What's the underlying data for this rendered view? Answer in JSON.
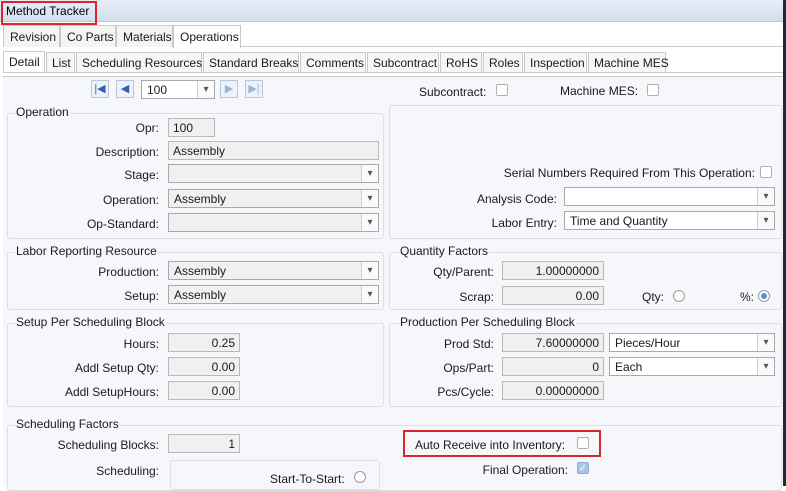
{
  "window": {
    "title": "Method Tracker"
  },
  "main_tabs": [
    {
      "label": "Revision",
      "active": false
    },
    {
      "label": "Co Parts",
      "active": false
    },
    {
      "label": "Materials",
      "active": false
    },
    {
      "label": "Operations",
      "active": true
    }
  ],
  "sub_tabs": [
    {
      "label": "Detail",
      "active": true
    },
    {
      "label": "List"
    },
    {
      "label": "Scheduling Resources"
    },
    {
      "label": "Standard Breaks"
    },
    {
      "label": "Comments"
    },
    {
      "label": "Subcontract"
    },
    {
      "label": "RoHS"
    },
    {
      "label": "Roles"
    },
    {
      "label": "Inspection"
    },
    {
      "label": "Machine MES"
    }
  ],
  "navigator": {
    "value": "100"
  },
  "top_flags": {
    "subcontract_label": "Subcontract:",
    "machine_mes_label": "Machine MES:"
  },
  "operation": {
    "title": "Operation",
    "opr_label": "Opr:",
    "opr_value": "100",
    "description_label": "Description:",
    "description_value": "Assembly",
    "stage_label": "Stage:",
    "stage_value": "",
    "operation_label": "Operation:",
    "operation_value": "Assembly",
    "opstandard_label": "Op-Standard:",
    "opstandard_value": ""
  },
  "right_panel": {
    "serial_label": "Serial Numbers Required From This Operation:",
    "analysis_label": "Analysis Code:",
    "analysis_value": "",
    "labor_entry_label": "Labor Entry:",
    "labor_entry_value": "Time and Quantity"
  },
  "labor_reporting": {
    "title": "Labor Reporting Resource",
    "production_label": "Production:",
    "production_value": "Assembly",
    "setup_label": "Setup:",
    "setup_value": "Assembly"
  },
  "quantity_factors": {
    "title": "Quantity Factors",
    "qty_parent_label": "Qty/Parent:",
    "qty_parent_value": "1.00000000",
    "scrap_label": "Scrap:",
    "scrap_value": "0.00",
    "qty_label": "Qty:",
    "pct_label": "%:"
  },
  "setup_block": {
    "title": "Setup Per Scheduling Block",
    "hours_label": "Hours:",
    "hours_value": "0.25",
    "addl_qty_label": "Addl Setup Qty:",
    "addl_qty_value": "0.00",
    "addl_hours_label": "Addl SetupHours:",
    "addl_hours_value": "0.00"
  },
  "production_block": {
    "title": "Production Per Scheduling Block",
    "prod_std_label": "Prod Std:",
    "prod_std_value": "7.60000000",
    "prod_std_unit": "Pieces/Hour",
    "ops_part_label": "Ops/Part:",
    "ops_part_value": "0",
    "ops_part_unit": "Each",
    "pcs_cycle_label": "Pcs/Cycle:",
    "pcs_cycle_value": "0.00000000"
  },
  "scheduling_factors": {
    "title": "Scheduling Factors",
    "blocks_label": "Scheduling Blocks:",
    "blocks_value": "1",
    "scheduling_label": "Scheduling:",
    "start_to_start_label": "Start-To-Start:",
    "auto_receive_label": "Auto Receive into Inventory:",
    "final_operation_label": "Final Operation:"
  },
  "colors": {
    "highlight": "#d9262c",
    "accent": "#5b8fd3"
  }
}
